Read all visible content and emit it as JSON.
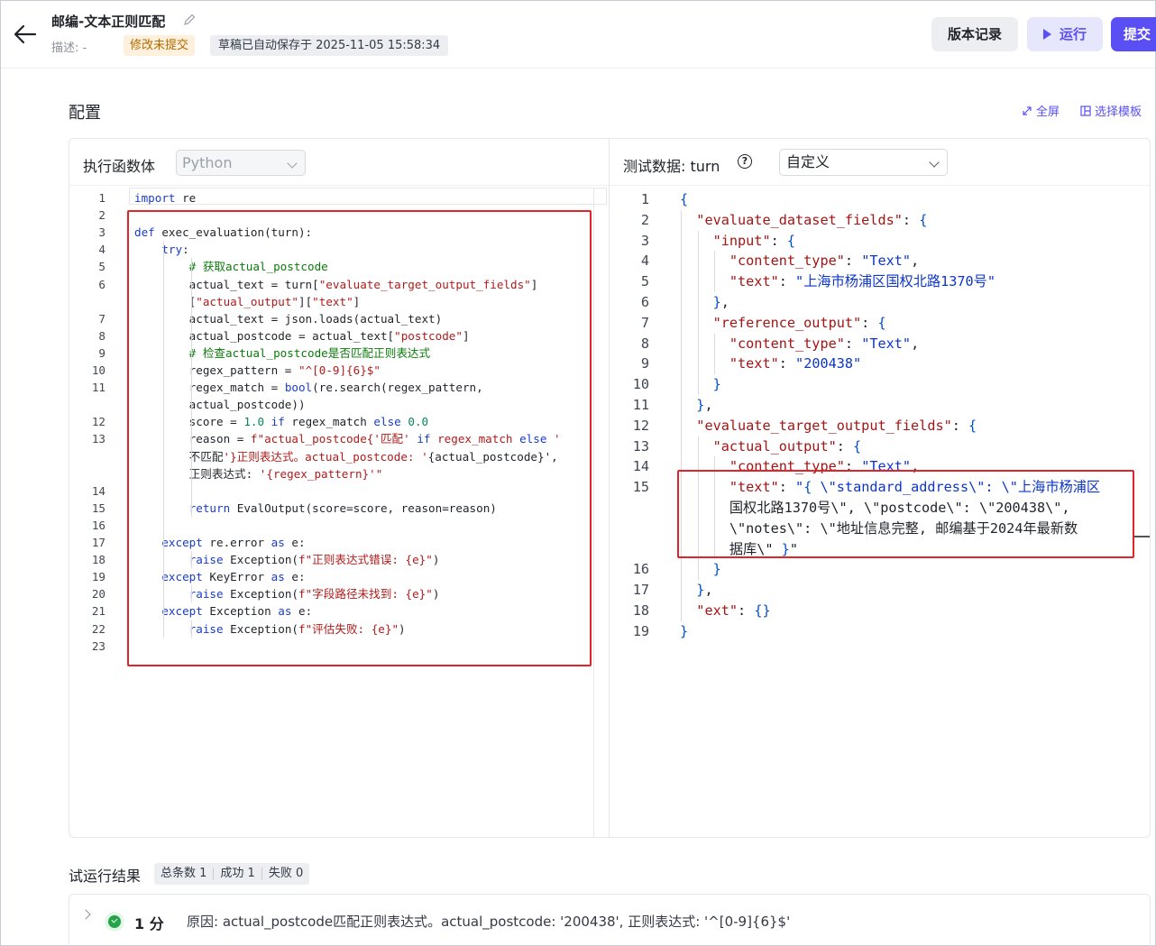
{
  "header": {
    "title": "邮编-文本正则匹配",
    "description": "描述: -",
    "tag_unsaved": "修改未提交",
    "tag_draft": "草稿已自动保存于 2025-11-05 15:58:34",
    "btn_history": "版本记录",
    "btn_run": "运行",
    "btn_submit": "提交"
  },
  "config": {
    "title": "配置",
    "fullscreen": "全屏",
    "select_template": "选择模板"
  },
  "left_panel": {
    "label": "执行函数体",
    "language": "Python"
  },
  "right_panel": {
    "label": "测试数据:",
    "turn": "turn",
    "help": "?",
    "mode": "自定义"
  },
  "python_lines": [
    {
      "n": "1",
      "t": "import re"
    },
    {
      "n": "2",
      "t": ""
    },
    {
      "n": "3",
      "t": "def exec_evaluation(turn):"
    },
    {
      "n": "4",
      "t": "    try:"
    },
    {
      "n": "5",
      "t": "        # 获取actual_postcode"
    },
    {
      "n": "6",
      "t": "        actual_text = turn[\"evaluate_target_output_fields\"]"
    },
    {
      "n": "",
      "t": "        [\"actual_output\"][\"text\"]"
    },
    {
      "n": "7",
      "t": "        actual_text = json.loads(actual_text)"
    },
    {
      "n": "8",
      "t": "        actual_postcode = actual_text[\"postcode\"]"
    },
    {
      "n": "9",
      "t": "        # 检查actual_postcode是否匹配正则表达式"
    },
    {
      "n": "10",
      "t": "        regex_pattern = \"^[0-9]{6}$\""
    },
    {
      "n": "11",
      "t": "        regex_match = bool(re.search(regex_pattern,"
    },
    {
      "n": "",
      "t": "        actual_postcode))"
    },
    {
      "n": "12",
      "t": "        score = 1.0 if regex_match else 0.0"
    },
    {
      "n": "13",
      "t": "        reason = f\"actual_postcode{'匹配' if regex_match else '"
    },
    {
      "n": "",
      "t": "        不匹配'}正则表达式。actual_postcode: '{actual_postcode}',"
    },
    {
      "n": "",
      "t": "        正则表达式: '{regex_pattern}'\""
    },
    {
      "n": "14",
      "t": ""
    },
    {
      "n": "15",
      "t": "        return EvalOutput(score=score, reason=reason)"
    },
    {
      "n": "16",
      "t": ""
    },
    {
      "n": "17",
      "t": "    except re.error as e:"
    },
    {
      "n": "18",
      "t": "        raise Exception(f\"正则表达式错误: {e}\")"
    },
    {
      "n": "19",
      "t": "    except KeyError as e:"
    },
    {
      "n": "20",
      "t": "        raise Exception(f\"字段路径未找到: {e}\")"
    },
    {
      "n": "21",
      "t": "    except Exception as e:"
    },
    {
      "n": "22",
      "t": "        raise Exception(f\"评估失败: {e}\")"
    },
    {
      "n": "23",
      "t": ""
    }
  ],
  "json_lines": [
    {
      "n": "1",
      "t": "{"
    },
    {
      "n": "2",
      "t": "  \"evaluate_dataset_fields\": {"
    },
    {
      "n": "3",
      "t": "    \"input\": {"
    },
    {
      "n": "4",
      "t": "      \"content_type\": \"Text\","
    },
    {
      "n": "5",
      "t": "      \"text\": \"上海市杨浦区国权北路1370号\""
    },
    {
      "n": "6",
      "t": "    },"
    },
    {
      "n": "7",
      "t": "    \"reference_output\": {"
    },
    {
      "n": "8",
      "t": "      \"content_type\": \"Text\","
    },
    {
      "n": "9",
      "t": "      \"text\": \"200438\""
    },
    {
      "n": "10",
      "t": "    }"
    },
    {
      "n": "11",
      "t": "  },"
    },
    {
      "n": "12",
      "t": "  \"evaluate_target_output_fields\": {"
    },
    {
      "n": "13",
      "t": "    \"actual_output\": {"
    },
    {
      "n": "14",
      "t": "      \"content_type\": \"Text\","
    },
    {
      "n": "15",
      "t": "      \"text\": \"{ \\\"standard_address\\\": \\\"上海市杨浦区"
    },
    {
      "n": "",
      "t": "      国权北路1370号\\\", \\\"postcode\\\": \\\"200438\\\","
    },
    {
      "n": "",
      "t": "      \\\"notes\\\": \\\"地址信息完整, 邮编基于2024年最新数"
    },
    {
      "n": "",
      "t": "      据库\\\" }\""
    },
    {
      "n": "16",
      "t": "    }"
    },
    {
      "n": "17",
      "t": "  },"
    },
    {
      "n": "18",
      "t": "  \"ext\": {}"
    },
    {
      "n": "19",
      "t": "}"
    }
  ],
  "results": {
    "title": "试运行结果",
    "total": "总条数 1",
    "success": "成功 1",
    "fail": "失败 0",
    "row_score": "1 分",
    "row_reason": "原因: actual_postcode匹配正则表达式。actual_postcode: '200438', 正则表达式: '^[0-9]{6}$'"
  },
  "colors": {
    "accent": "#5a4ff5",
    "highlight_box": "#e0242a",
    "success": "#22a447"
  }
}
